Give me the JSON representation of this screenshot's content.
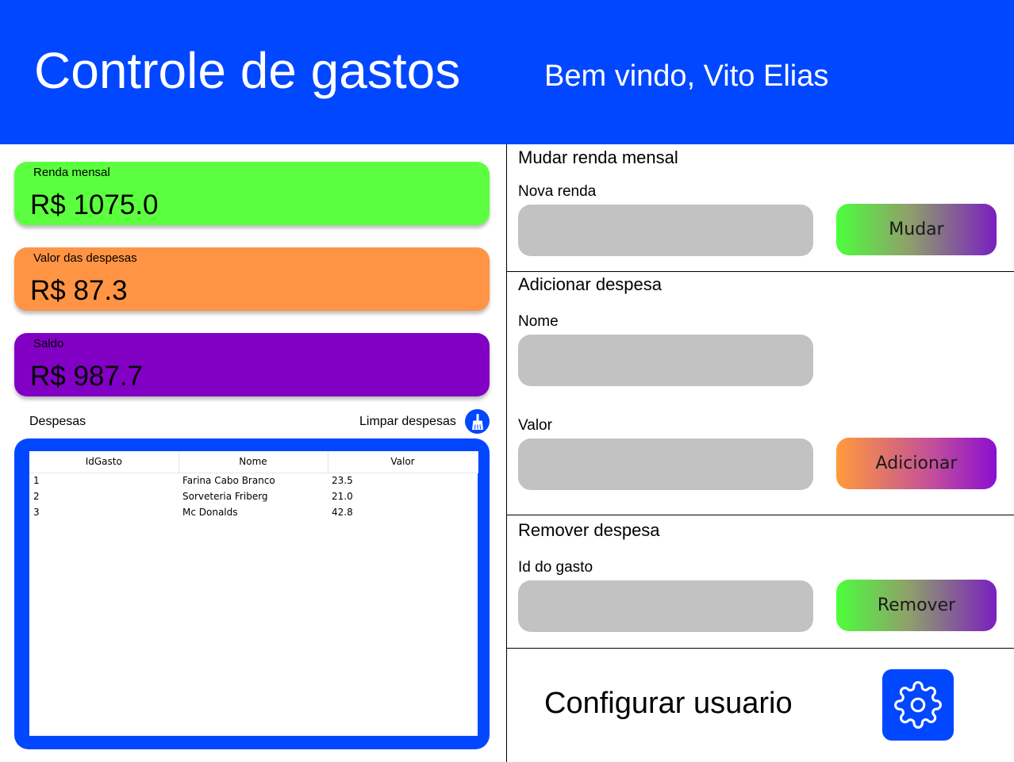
{
  "header": {
    "title": "Controle de gastos",
    "welcome": "Bem vindo, Vito Elias",
    "color": "#0047ff"
  },
  "summary": {
    "renda": {
      "label": "Renda mensal",
      "value": "R$ 1075.0",
      "color": "#5cff3f"
    },
    "despesas": {
      "label": "Valor das despesas",
      "value": "R$ 87.3",
      "color": "#ff9444"
    },
    "saldo": {
      "label": "Saldo",
      "value": "R$ 987.7",
      "color": "#8200c4"
    }
  },
  "expenses": {
    "title": "Despesas",
    "clear_label": "Limpar despesas",
    "clear_icon": "broom-icon",
    "columns": [
      "IdGasto",
      "Nome",
      "Valor"
    ],
    "rows": [
      [
        "1",
        "Farina Cabo Branco",
        "23.5"
      ],
      [
        "2",
        "Sorveteria Friberg",
        "21.0"
      ],
      [
        "3",
        "Mc Donalds",
        "42.8"
      ]
    ]
  },
  "change_income": {
    "title": "Mudar renda mensal",
    "field_label": "Nova renda",
    "field_value": "",
    "button_label": "Mudar"
  },
  "add_expense": {
    "title": "Adicionar despesa",
    "name_label": "Nome",
    "name_value": "",
    "value_label": "Valor",
    "value_value": "",
    "button_label": "Adicionar"
  },
  "remove_expense": {
    "title": "Remover despesa",
    "field_label": "Id do gasto",
    "field_value": "",
    "button_label": "Remover"
  },
  "config": {
    "label": "Configurar usuario",
    "icon": "gear-icon"
  }
}
